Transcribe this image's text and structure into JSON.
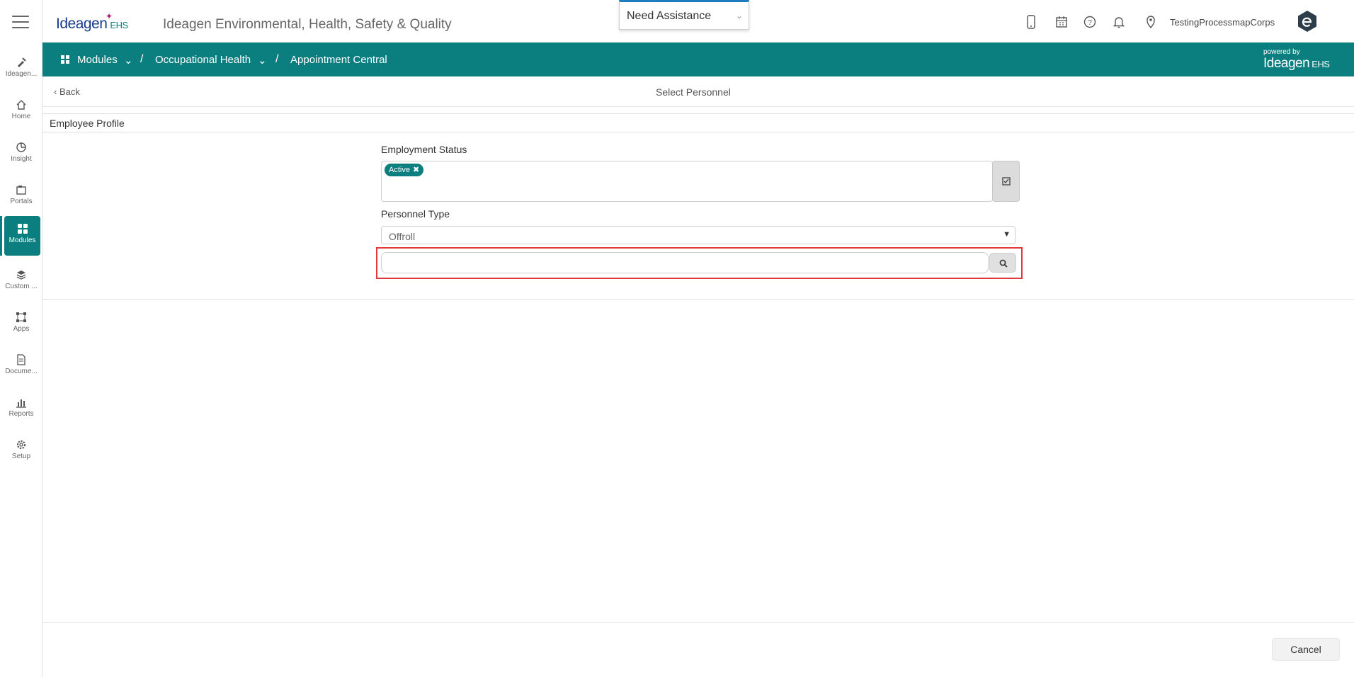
{
  "header": {
    "logo_text": "Ideagen",
    "logo_suffix": "EHS",
    "app_title": "Ideagen Environmental, Health, Safety & Quality",
    "assistance_label": "Need Assistance",
    "user_name": "TestingProcessmapCorps",
    "icons": [
      "mobile-icon",
      "calendar-icon",
      "help-icon",
      "bell-icon",
      "location-pin-icon"
    ]
  },
  "rail": {
    "items": [
      {
        "label": "Ideagen...",
        "icon": "pen-icon"
      },
      {
        "label": "Home",
        "icon": "home-icon"
      },
      {
        "label": "Insight",
        "icon": "pie-chart-icon"
      },
      {
        "label": "Portals",
        "icon": "portal-icon"
      },
      {
        "label": "Modules",
        "icon": "grid-icon",
        "active": true
      },
      {
        "label": "Custom ...",
        "icon": "layers-icon"
      },
      {
        "label": "Apps",
        "icon": "apps-icon"
      },
      {
        "label": "Docume...",
        "icon": "document-icon"
      },
      {
        "label": "Reports",
        "icon": "bar-chart-icon"
      },
      {
        "label": "Setup",
        "icon": "gear-icon"
      }
    ]
  },
  "breadcrumb": {
    "items": [
      "Modules",
      "Occupational Health",
      "Appointment Central"
    ],
    "powered_by": "powered by",
    "powered_logo": "Ideagen",
    "powered_suffix": "EHS"
  },
  "subheader": {
    "back_label": "Back",
    "page_title": "Select Personnel"
  },
  "panel": {
    "title": "Employee Profile",
    "employment_status_label": "Employment Status",
    "employment_status_tags": [
      "Active"
    ],
    "personnel_type_label": "Personnel Type",
    "personnel_type_value": "Offroll",
    "search_value": ""
  },
  "footer": {
    "cancel_label": "Cancel"
  },
  "colors": {
    "primary_teal": "#0b7f7f",
    "highlight_red": "#e03a3a",
    "assist_accent": "#1e7fc0"
  }
}
